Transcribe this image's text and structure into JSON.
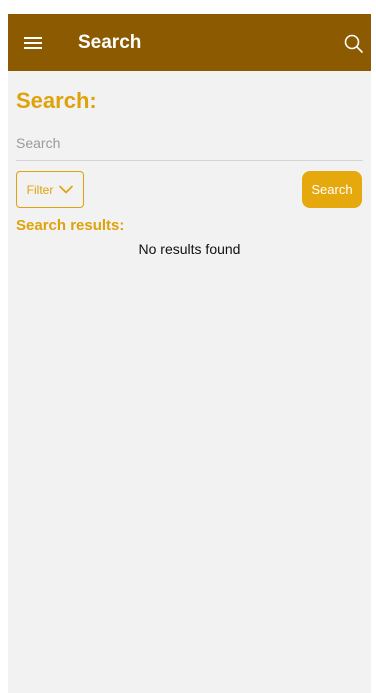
{
  "appbar": {
    "title": "Search",
    "menu_icon": "hamburger-menu-icon",
    "search_icon": "search-icon",
    "background_color": "#8c5a00"
  },
  "search": {
    "heading": "Search:",
    "input_placeholder": "Search",
    "input_value": "",
    "filter_label": "Filter",
    "filter_icon": "chevron-down-icon",
    "search_button_label": "Search"
  },
  "results": {
    "heading": "Search results:",
    "empty_message": "No results found"
  },
  "colors": {
    "accent": "#e0a20b",
    "button": "#e5a90e",
    "surface": "#f2f2f2"
  }
}
